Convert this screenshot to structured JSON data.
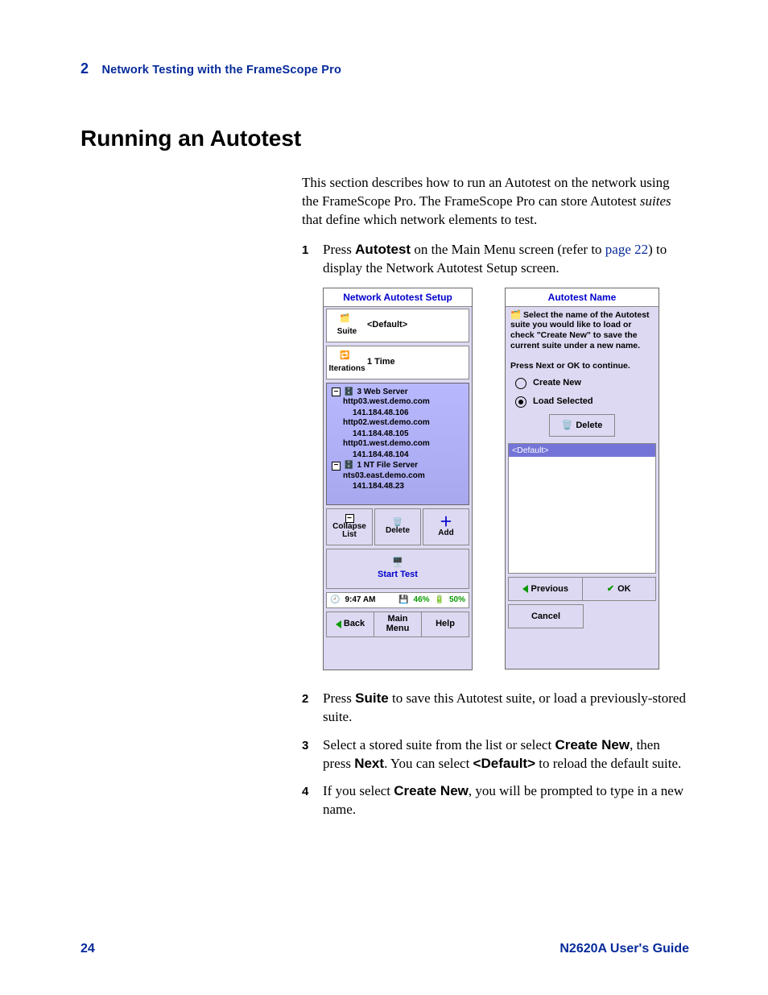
{
  "header": {
    "chapter_num": "2",
    "chapter_title": "Network Testing with the FrameScope Pro"
  },
  "section_title": "Running an Autotest",
  "intro_pre": "This section describes how to run an Autotest on the network using the FrameScope Pro. The FrameScope Pro can store Autotest ",
  "intro_em": "suites",
  "intro_post": " that define which network elements to test.",
  "step1_a": "Press ",
  "step1_b": "Autotest",
  "step1_c": " on the Main Menu screen (refer to ",
  "step1_link": "page 22",
  "step1_d": ") to display the Network Autotest Setup screen.",
  "screen1": {
    "title": "Network Autotest Setup",
    "suite_label": "Suite",
    "suite_value": "<Default>",
    "iter_label": "Iterations",
    "iter_value": "1 Time",
    "tree": {
      "g1_title": "3 Web Server",
      "g1_items": [
        {
          "host": "http03.west.demo.com",
          "ip": "141.184.48.106"
        },
        {
          "host": "http02.west.demo.com",
          "ip": "141.184.48.105"
        },
        {
          "host": "http01.west.demo.com",
          "ip": "141.184.48.104"
        }
      ],
      "g2_title": "1 NT File Server",
      "g2_items": [
        {
          "host": "nts03.east.demo.com",
          "ip": "141.184.48.23"
        }
      ]
    },
    "btn_collapse": "Collapse\nList",
    "btn_delete": "Delete",
    "btn_add": "Add",
    "start": "Start Test",
    "status_time": "9:47 AM",
    "status_mem": "46%",
    "status_batt": "50%",
    "nav_back": "Back",
    "nav_main": "Main\nMenu",
    "nav_help": "Help"
  },
  "screen2": {
    "title": "Autotest Name",
    "instr_a": "Select the name of the Autotest suite you would like to load or check \"Create New\" to save the current suite under a new name.",
    "instr_b": "Press Next or OK to continue.",
    "opt_create": "Create New",
    "opt_load": "Load Selected",
    "delete": "Delete",
    "list_selected": "<Default>",
    "previous": "Previous",
    "ok": "OK",
    "cancel": "Cancel"
  },
  "step2_a": "Press ",
  "step2_b": "Suite",
  "step2_c": " to save this Autotest suite, or load a previously-stored suite.",
  "step3_a": "Select a stored suite from the list or select ",
  "step3_b": "Create New",
  "step3_c": ", then press ",
  "step3_d": "Next",
  "step3_e": ". You can select ",
  "step3_f": "<Default>",
  "step3_g": " to reload the default suite.",
  "step4_a": "If you select ",
  "step4_b": "Create New",
  "step4_c": ", you will be prompted to type in a new name.",
  "footer": {
    "page": "24",
    "guide": "N2620A User's Guide"
  }
}
